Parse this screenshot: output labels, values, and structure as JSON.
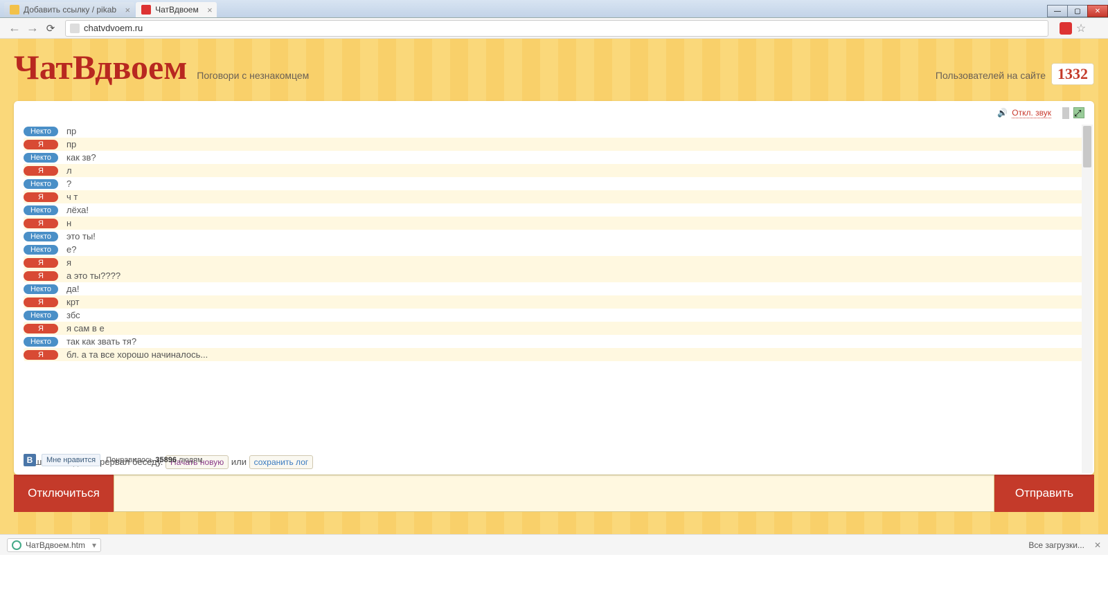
{
  "browser": {
    "tabs": [
      {
        "title": "Добавить ссылку / pikab",
        "active": false,
        "favicon": "#f2c14a"
      },
      {
        "title": "ЧатВдвоем",
        "active": true,
        "favicon": "#d33"
      }
    ],
    "url": "chatvdvoem.ru"
  },
  "window": {
    "min": "—",
    "max": "▢",
    "close": "✕"
  },
  "header": {
    "logo": "ЧатВдвоем",
    "tagline": "Поговори с незнакомцем",
    "users_label": "Пользователей на сайте",
    "users_count": "1332"
  },
  "topbar": {
    "sound_label": "Откл. звук",
    "swatches": [
      "#f9e6a6",
      "#ececec",
      "#3a7ac0",
      "#2a9a82",
      "#d84a34"
    ]
  },
  "labels": {
    "nekto": "Некто",
    "ya": "Я"
  },
  "messages": [
    {
      "who": "nekto",
      "text": "пр"
    },
    {
      "who": "ya",
      "text": "пр"
    },
    {
      "who": "nekto",
      "text": "как зв?"
    },
    {
      "who": "ya",
      "text": "л"
    },
    {
      "who": "nekto",
      "text": "?"
    },
    {
      "who": "ya",
      "text": "ч т"
    },
    {
      "who": "nekto",
      "text": "лёха!"
    },
    {
      "who": "ya",
      "text": "н"
    },
    {
      "who": "nekto",
      "text": "это ты!"
    },
    {
      "who": "nekto",
      "text": "е?"
    },
    {
      "who": "ya",
      "text": "я"
    },
    {
      "who": "ya",
      "text": "а это ты????"
    },
    {
      "who": "nekto",
      "text": "да!"
    },
    {
      "who": "ya",
      "text": "крт"
    },
    {
      "who": "nekto",
      "text": "збс"
    },
    {
      "who": "ya",
      "text": "я сам в е"
    },
    {
      "who": "nekto",
      "text": "так как звать тя?"
    },
    {
      "who": "ya",
      "text": "бл. а та все хорошо начиналось..."
    }
  ],
  "end": {
    "notice": "Ваш собеседник прервал беседу.",
    "new_chat": "Начать новую",
    "or": "или",
    "save_log": "сохранить лог"
  },
  "vk": {
    "like_label": "Мне нравится",
    "likes_prefix": "Понравилось",
    "likes_count": "35896",
    "likes_suffix": "людям"
  },
  "buttons": {
    "disconnect": "Отключиться",
    "send": "Отправить"
  },
  "downloads": {
    "file": "ЧатВдвоем.htm",
    "all": "Все загрузки..."
  }
}
